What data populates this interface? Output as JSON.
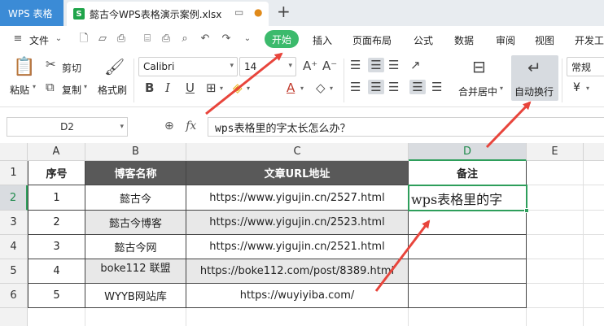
{
  "titlebar": {
    "app_label": "WPS 表格",
    "file_icon": "S",
    "file_name": "懿古今WPS表格演示案例.xlsx",
    "new_tab": "+"
  },
  "menu": {
    "file_label": "文件",
    "items": [
      "开始",
      "插入",
      "页面布局",
      "公式",
      "数据",
      "审阅",
      "视图",
      "开发工"
    ]
  },
  "ribbon": {
    "paste": "粘贴",
    "cut": "剪切",
    "copy": "复制",
    "format_painter": "格式刷",
    "font_name": "Calibri",
    "font_size": "14",
    "merge": "合并居中",
    "wrap": "自动换行",
    "number_format": "常规",
    "currency": "¥"
  },
  "formula_bar": {
    "name_box": "D2",
    "fx": "fx",
    "value": "wps表格里的字太长怎么办？"
  },
  "grid": {
    "columns": [
      "A",
      "B",
      "C",
      "D",
      "E"
    ],
    "rows": [
      "1",
      "2",
      "3",
      "4",
      "5",
      "6"
    ],
    "header": [
      "序号",
      "博客名称",
      "文章URL地址",
      "备注"
    ],
    "data": [
      [
        "1",
        "懿古今",
        "https://www.yigujin.cn/2527.html"
      ],
      [
        "2",
        "懿古今博客",
        "https://www.yigujin.cn/2523.html"
      ],
      [
        "3",
        "懿古今网",
        "https://www.yigujin.cn/2521.html"
      ],
      [
        "4",
        "boke112 联盟",
        "https://boke112.com/post/8389.html"
      ],
      [
        "5",
        "WYYB网站库",
        "https://wuyiyiba.com/"
      ]
    ],
    "active_cell_text": "wps表格里的字"
  },
  "colors": {
    "accent_green": "#3cba6c",
    "header_fill": "#595959",
    "arrow_red": "#e8453c"
  }
}
